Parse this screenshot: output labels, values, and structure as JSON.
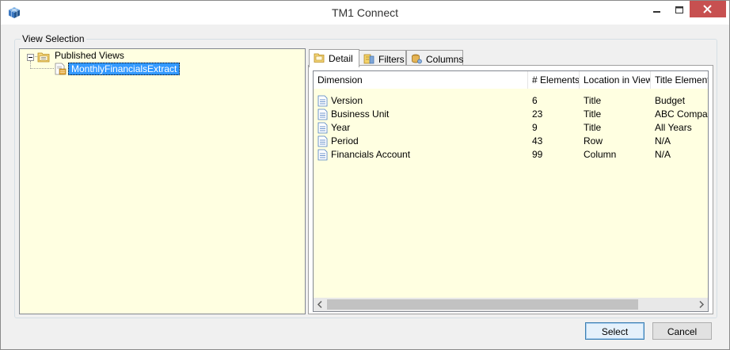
{
  "window": {
    "title": "TM1 Connect"
  },
  "group": {
    "legend": "View Selection"
  },
  "tree": {
    "root_label": "Published Views",
    "child_label": "MonthlyFinancialsExtract"
  },
  "tabs": [
    {
      "label": "Detail",
      "icon": "detail-tab-icon",
      "active": true
    },
    {
      "label": "Filters",
      "icon": "filters-tab-icon",
      "active": false
    },
    {
      "label": "Columns",
      "icon": "columns-tab-icon",
      "active": false
    }
  ],
  "detail_table": {
    "columns": [
      "Dimension",
      "# Elements",
      "Location in View",
      "Title Element"
    ],
    "rows": [
      {
        "dimension": "Version",
        "elements": "6",
        "location": "Title",
        "title_element": "Budget"
      },
      {
        "dimension": "Business Unit",
        "elements": "23",
        "location": "Title",
        "title_element": "ABC Company"
      },
      {
        "dimension": "Year",
        "elements": "9",
        "location": "Title",
        "title_element": "All Years"
      },
      {
        "dimension": "Period",
        "elements": "43",
        "location": "Row",
        "title_element": "N/A"
      },
      {
        "dimension": "Financials Account",
        "elements": "99",
        "location": "Column",
        "title_element": "N/A"
      }
    ]
  },
  "buttons": {
    "select": "Select",
    "cancel": "Cancel"
  },
  "colors": {
    "pane_background": "#ffffe1",
    "selection": "#3399ff",
    "close_button": "#c75050"
  }
}
